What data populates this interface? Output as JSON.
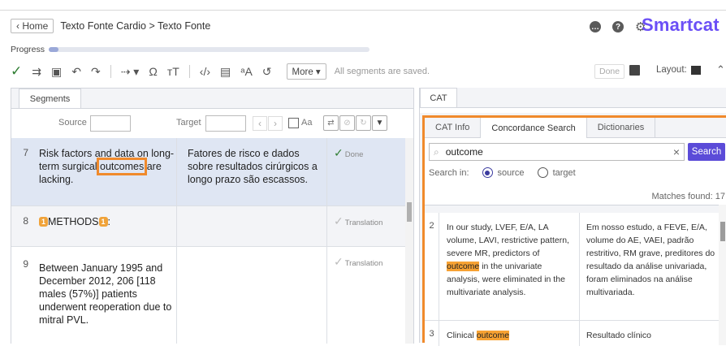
{
  "header": {
    "home_label": "Home",
    "breadcrumb": "Texto Fonte Cardio > Texto Fonte",
    "brand": "Smartcat"
  },
  "progress": {
    "label": "Progress",
    "fraction": 0.03
  },
  "toolbar": {
    "more_label": "More",
    "status_text": "All segments are saved.",
    "done_label": "Done",
    "layout_label": "Layout:"
  },
  "left": {
    "tab_label": "Segments",
    "source_label": "Source",
    "target_label": "Target",
    "case_label": "Aa",
    "segments": [
      {
        "num": "7",
        "src_pre": "Risk factors and data on long-term surgical ",
        "src_hl": "outcomes",
        "src_post": " are lacking.",
        "target": "Fatores de risco e dados sobre resultados cirúrgicos a longo prazo são escassos.",
        "status": "Done"
      },
      {
        "num": "8",
        "tag1": "1",
        "src_text": "METHODS",
        "tag2": "1",
        "src_after": ":",
        "target": "",
        "status": "Translation"
      },
      {
        "num": "9",
        "source": "Between January 1995 and December 2012, 206 [118 males (57%)] patients underwent reoperation due to mitral PVL.",
        "target": "",
        "status": "Translation"
      }
    ]
  },
  "right": {
    "tab_label": "CAT",
    "subtabs": [
      "CAT Info",
      "Concordance Search",
      "Dictionaries"
    ],
    "search_value": "outcome",
    "search_button": "Search",
    "search_in_label": "Search in:",
    "radio_source": "source",
    "radio_target": "target",
    "matches_text": "Matches found: 17",
    "results": [
      {
        "num": "2",
        "src_pre": "In our study, LVEF, E/A, LA volume, LAVI, restrictive pattern, severe MR, predictors of ",
        "src_hl": "outcome",
        "src_post": " in the univariate analysis, were eliminated in the multivariate analysis.",
        "target": "Em nosso estudo, a FEVE, E/A, volume do AE, VAEI, padrão restritivo, RM grave, preditores do resultado da análise univariada, foram eliminados na análise multivariada."
      },
      {
        "num": "3",
        "src_pre": "Clinical ",
        "src_hl": "outcome",
        "src_post": "",
        "target": "Resultado clínico"
      }
    ]
  },
  "colors": {
    "brand": "#6b4ff6",
    "highlight": "#f08a2c",
    "search_button": "#5b4bd8",
    "done_check": "#2e7d32"
  }
}
